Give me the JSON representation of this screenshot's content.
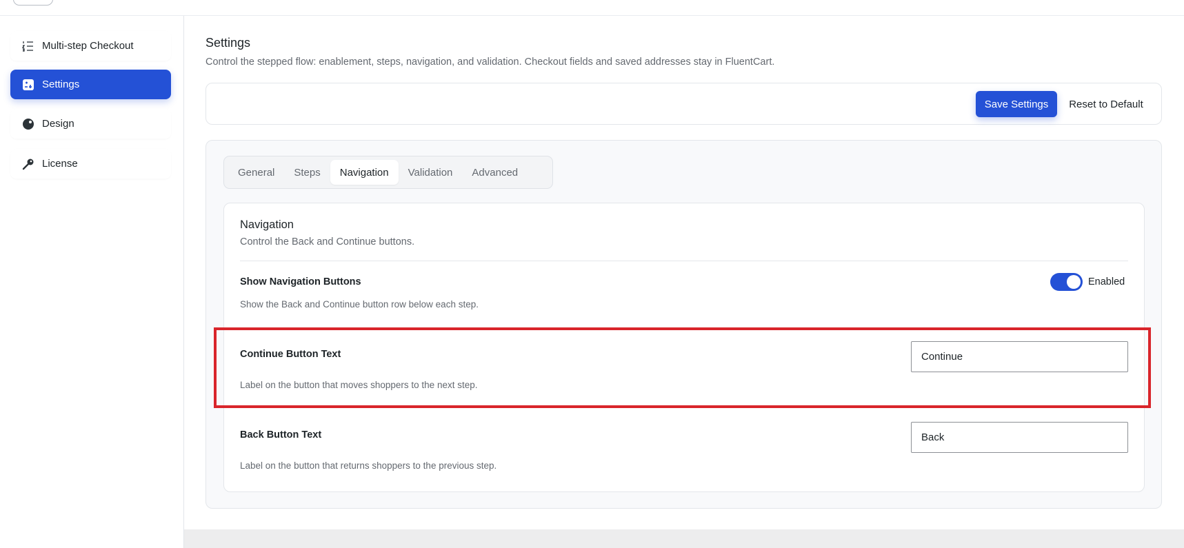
{
  "sidebar": {
    "items": [
      {
        "label": "Multi-step Checkout",
        "icon": "list-numbered-icon",
        "active": false
      },
      {
        "label": "Settings",
        "icon": "settings-panel-icon",
        "active": true
      },
      {
        "label": "Design",
        "icon": "palette-icon",
        "active": false
      },
      {
        "label": "License",
        "icon": "key-icon",
        "active": false
      }
    ]
  },
  "page": {
    "title": "Settings",
    "description": "Control the stepped flow: enablement, steps, navigation, and validation. Checkout fields and saved addresses stay in FluentCart."
  },
  "toolbar": {
    "save_label": "Save Settings",
    "reset_label": "Reset to Default"
  },
  "tabs": [
    {
      "label": "General",
      "active": false
    },
    {
      "label": "Steps",
      "active": false
    },
    {
      "label": "Navigation",
      "active": true
    },
    {
      "label": "Validation",
      "active": false
    },
    {
      "label": "Advanced",
      "active": false
    }
  ],
  "section": {
    "title": "Navigation",
    "description": "Control the Back and Continue buttons.",
    "rows": {
      "show_nav": {
        "label": "Show Navigation Buttons",
        "help": "Show the Back and Continue button row below each step.",
        "toggle_state": "Enabled"
      },
      "continue_text": {
        "label": "Continue Button Text",
        "help": "Label on the button that moves shoppers to the next step.",
        "value": "Continue"
      },
      "back_text": {
        "label": "Back Button Text",
        "help": "Label on the button that returns shoppers to the previous step.",
        "value": "Back"
      }
    }
  },
  "colors": {
    "accent": "#2451d6",
    "highlight": "#d9252b"
  }
}
